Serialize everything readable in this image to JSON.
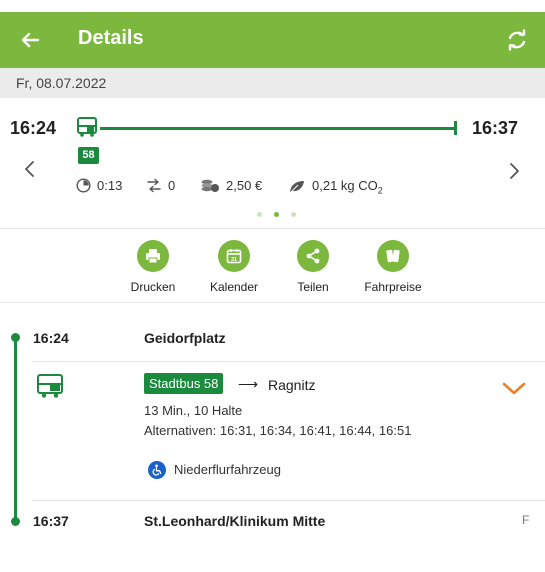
{
  "appbar": {
    "title": "Details"
  },
  "date": "Fr, 08.07.2022",
  "summary": {
    "departure": "16:24",
    "arrival": "16:37",
    "line_badge": "58",
    "duration": "0:13",
    "transfers": "0",
    "price": "2,50 €",
    "co2_value": "0,21 kg CO",
    "co2_sub": "2",
    "page_count": 3,
    "page_index": 1
  },
  "actions": [
    {
      "label": "Drucken",
      "icon": "printer-icon"
    },
    {
      "label": "Kalender",
      "icon": "calendar-icon",
      "day": "31"
    },
    {
      "label": "Teilen",
      "icon": "share-icon"
    },
    {
      "label": "Fahrpreise",
      "icon": "tickets-icon"
    }
  ],
  "itinerary": {
    "start": {
      "time": "16:24",
      "stop": "Geidorfplatz"
    },
    "leg": {
      "line": "Stadtbus 58",
      "arrow": "⟶",
      "direction": "Ragnitz",
      "duration_stops": "13 Min., 10 Halte",
      "alternatives": "Alternativen: 16:31, 16:34, 16:41, 16:44, 16:51",
      "accessibility": "Niederflurfahrzeug"
    },
    "end": {
      "time": "16:37",
      "stop": "St.Leonhard/Klinikum Mitte",
      "platform": "F"
    }
  },
  "colors": {
    "brand_green": "#7cb83e",
    "route_green": "#1b8a3e",
    "expand_orange": "#e8832a",
    "wheelchair_blue": "#1a62c7"
  }
}
